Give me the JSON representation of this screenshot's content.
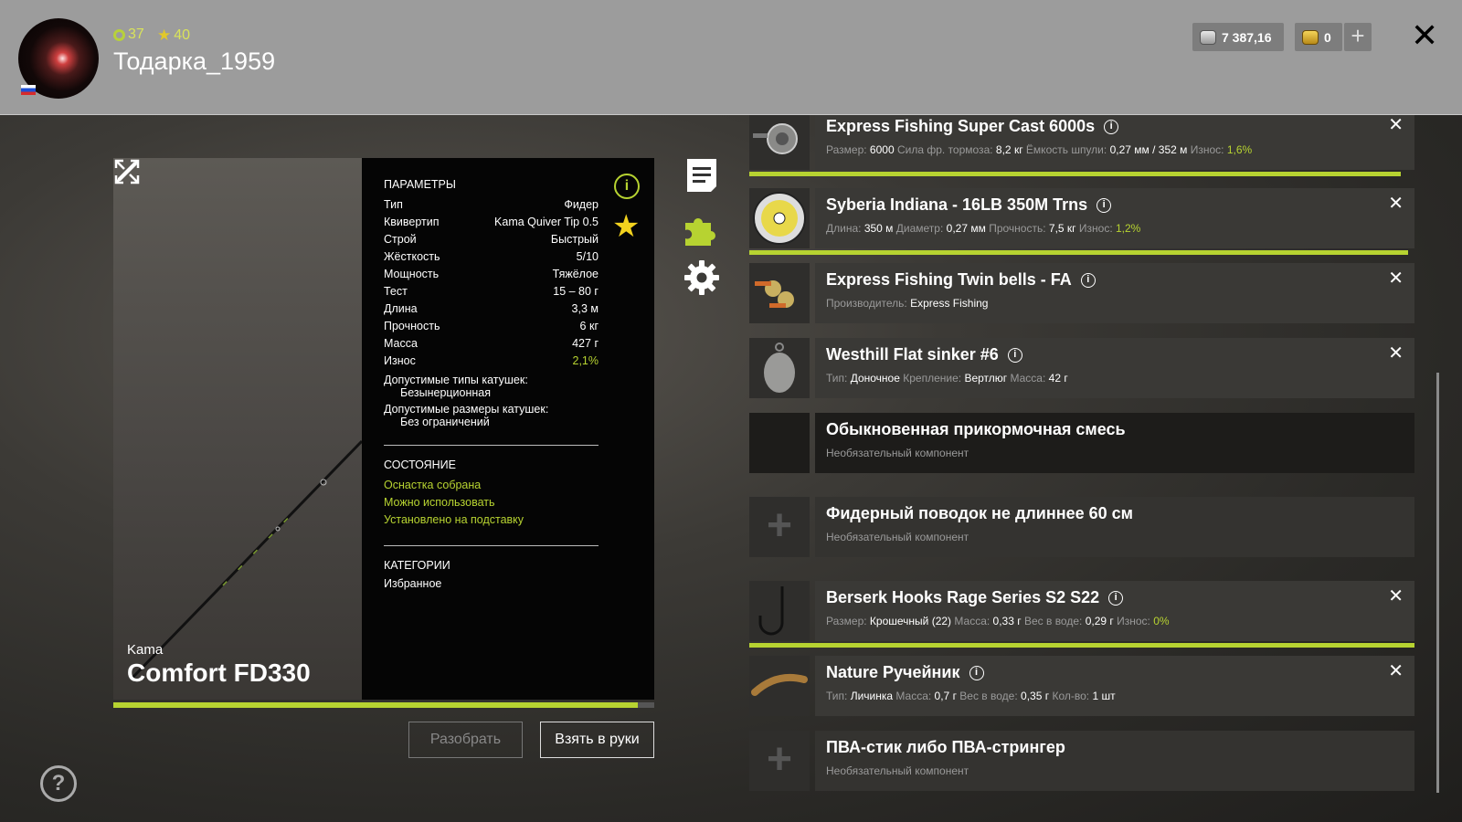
{
  "header": {
    "level": "37",
    "rating": "40",
    "username": "Тодарка_1959",
    "silver": "7 387,16",
    "gold": "0"
  },
  "rod": {
    "brand": "Kama",
    "name": "Comfort FD330",
    "condition_percent": 97
  },
  "params": {
    "heading": "ПАРАМЕТРЫ",
    "rows": [
      {
        "label": "Тип",
        "value": "Фидер"
      },
      {
        "label": "Квивертип",
        "value": "Kama Quiver Tip 0.5"
      },
      {
        "label": "Строй",
        "value": "Быстрый"
      },
      {
        "label": "Жёсткость",
        "value": "5/10"
      },
      {
        "label": "Мощность",
        "value": "Тяжёлое"
      },
      {
        "label": "Тест",
        "value": "15 – 80 г"
      },
      {
        "label": "Длина",
        "value": "3,3 м"
      },
      {
        "label": "Прочность",
        "value": "6 кг"
      },
      {
        "label": "Масса",
        "value": "427 г"
      },
      {
        "label": "Износ",
        "value": "2,1%"
      }
    ],
    "reel_types_label": "Допустимые типы катушек:",
    "reel_types_value": "Безынерционная",
    "reel_sizes_label": "Допустимые размеры катушек:",
    "reel_sizes_value": "Без ограничений",
    "state_heading": "СОСТОЯНИЕ",
    "states": [
      "Оснастка собрана",
      "Можно использовать",
      "Установлено на подставку"
    ],
    "categories_heading": "КАТЕГОРИИ",
    "category": "Избранное"
  },
  "buttons": {
    "disassemble": "Разобрать",
    "take": "Взять в руки"
  },
  "equipment": [
    {
      "title": "Express Fishing Super Cast 6000s",
      "meta": [
        [
          "Размер:",
          "6000"
        ],
        [
          "Сила фр. тормоза:",
          "8,2 кг"
        ],
        [
          "Ёмкость шпули:",
          "0,27 мм / 352 м"
        ],
        [
          "Износ:",
          "1,6%"
        ]
      ],
      "condition_percent": 98,
      "thumb": "reel"
    },
    {
      "title": "Syberia Indiana - 16LB 350M Trns",
      "meta": [
        [
          "Длина:",
          "350 м"
        ],
        [
          "Диаметр:",
          "0,27 мм"
        ],
        [
          "Прочность:",
          "7,5 кг"
        ],
        [
          "Износ:",
          "1,2%"
        ]
      ],
      "condition_percent": 99,
      "thumb": "line"
    },
    {
      "title": "Express Fishing Twin bells - FA",
      "meta": [
        [
          "Производитель:",
          "Express Fishing"
        ]
      ],
      "thumb": "bells"
    },
    {
      "title": "Westhill Flat sinker #6",
      "meta": [
        [
          "Тип:",
          "Доночное"
        ],
        [
          "Крепление:",
          "Вертлюг"
        ],
        [
          "Масса:",
          "42 г"
        ]
      ],
      "thumb": "sinker"
    },
    {
      "title": "Обыкновенная прикормочная смесь",
      "optional": "Необязательный компонент",
      "thumb": "empty"
    },
    {
      "title": "Фидерный поводок не длиннее 60 см",
      "optional": "Необязательный компонент",
      "thumb": "plus"
    },
    {
      "title": "Berserk Hooks Rage Series S2 S22",
      "meta": [
        [
          "Размер:",
          "Крошечный (22)"
        ],
        [
          "Масса:",
          "0,33 г"
        ],
        [
          "Вес в воде:",
          "0,29 г"
        ],
        [
          "Износ:",
          "0%"
        ]
      ],
      "condition_percent": 100,
      "thumb": "hook"
    },
    {
      "title": "Nature Ручейник",
      "meta": [
        [
          "Тип:",
          "Личинка"
        ],
        [
          "Масса:",
          "0,7 г"
        ],
        [
          "Вес в воде:",
          "0,35 г"
        ],
        [
          "Кол-во:",
          "1 шт"
        ]
      ],
      "thumb": "larva"
    },
    {
      "title": "ПВА-стик либо ПВА-стрингер",
      "optional": "Необязательный компонент",
      "thumb": "plus"
    }
  ],
  "icons": {
    "close": "close-icon",
    "help": "help-icon",
    "info": "info-icon",
    "favorite": "star-icon"
  },
  "colors": {
    "accent": "#b7d331",
    "star": "#f2d21e"
  }
}
